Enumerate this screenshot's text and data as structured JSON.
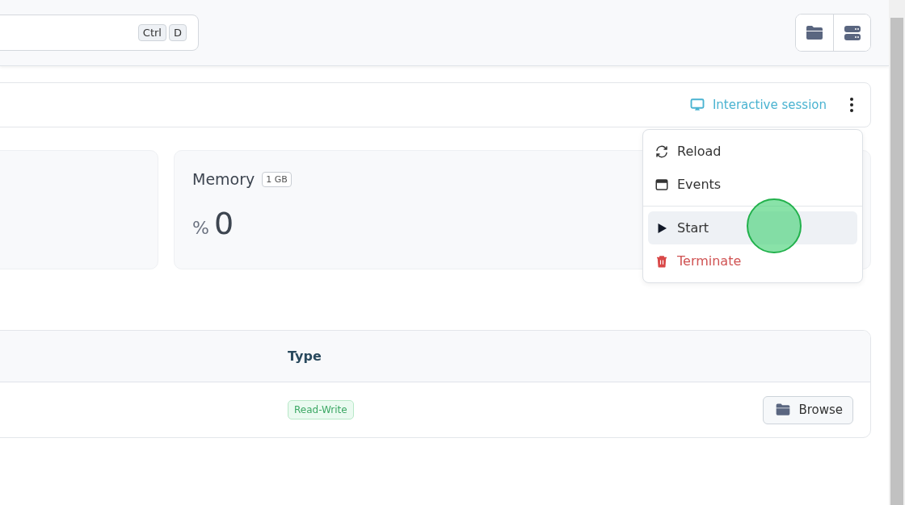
{
  "header": {
    "search": {
      "shortcut_keys": [
        "Ctrl",
        "D"
      ]
    },
    "toolbar_buttons": [
      {
        "kind": "folder"
      },
      {
        "kind": "server"
      }
    ]
  },
  "session_bar": {
    "session_label": "Interactive session"
  },
  "stats": [
    {
      "title": "Memory",
      "badge": "1 GB",
      "unit": "%",
      "value": "0"
    }
  ],
  "menu": {
    "items": [
      {
        "kind": "reload",
        "label": "Reload",
        "selected": false,
        "danger": false
      },
      {
        "kind": "events",
        "label": "Events",
        "selected": false,
        "danger": false
      },
      {
        "kind": "start",
        "label": "Start",
        "selected": true,
        "danger": false
      },
      {
        "kind": "terminate",
        "label": "Terminate",
        "selected": false,
        "danger": true
      }
    ]
  },
  "table": {
    "columns": [
      "Type"
    ],
    "rows": [
      {
        "type": "Read-Write",
        "action": "Browse"
      }
    ]
  }
}
